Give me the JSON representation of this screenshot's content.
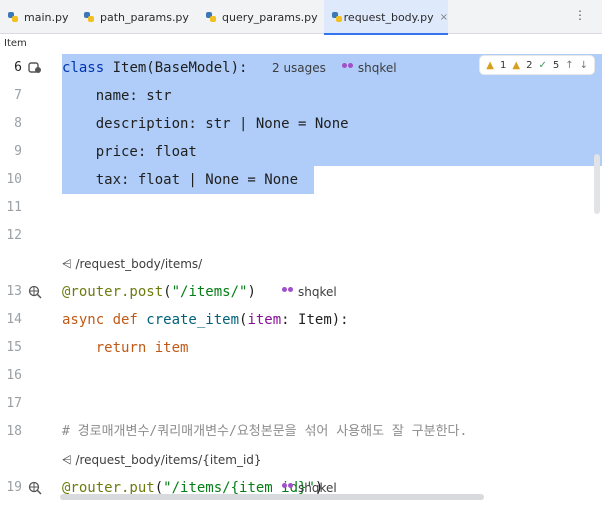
{
  "tabs": [
    {
      "label": "main.py",
      "active": false
    },
    {
      "label": "path_params.py",
      "active": false
    },
    {
      "label": "query_params.py",
      "active": false
    },
    {
      "label": "request_body.py",
      "active": true,
      "close": "×"
    }
  ],
  "tabbar_more": "⋮",
  "breadcrumb": "Item",
  "inspection": {
    "warnings": "1",
    "weak_warnings": "2",
    "typos": "5",
    "up": "↑",
    "down": "↓"
  },
  "line_numbers": [
    "6",
    "7",
    "8",
    "9",
    "10",
    "11",
    "12",
    "13",
    "14",
    "15",
    "16",
    "17",
    "18",
    "19"
  ],
  "hints": {
    "class_usages": "2 usages",
    "author": "shqkel",
    "route1": "/request_body/items/",
    "route2": "/request_body/items/{item_id}"
  },
  "code": {
    "l6_kw": "class",
    "l6_rest": " Item(BaseModel):",
    "l7": "    name: str",
    "l8": "    description: str | None = None",
    "l9": "    price: float",
    "l10": "    tax: float | None = None",
    "l13_dec": "@router.post",
    "l13_open": "(",
    "l13_str": "\"/items/\"",
    "l13_close": ")",
    "l14_kw": "async def",
    "l14_fn": " create_item",
    "l14_open": "(",
    "l14_param": "item",
    "l14_rest": ": Item):",
    "l15_kw": "    return",
    "l15_rest": " item",
    "l18": "# 경로매개변수/쿼리매개변수/요청본문을 섞어 사용해도 잘 구분한다.",
    "l19_dec": "@router.put",
    "l19_open": "(",
    "l19_str": "\"/items/{item_id}\"",
    "l19_close": ")"
  },
  "colors": {
    "selection": "#a6c8f7",
    "active_tab": "#dfe9fc",
    "accent": "#3574f0"
  }
}
